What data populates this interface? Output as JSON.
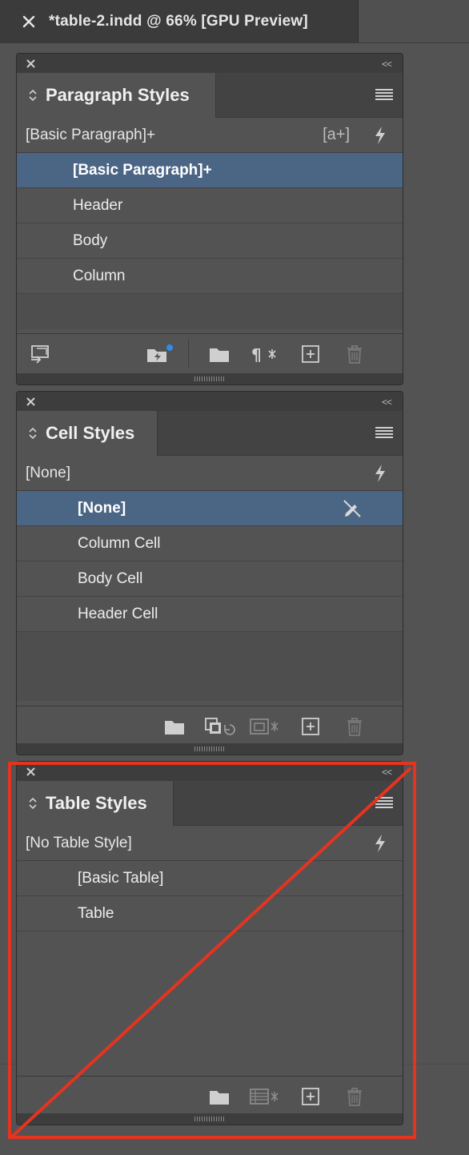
{
  "document_tab": {
    "title": "*table-2.indd @ 66% [GPU Preview]"
  },
  "panels": {
    "paragraph_styles": {
      "title": "Paragraph Styles",
      "current": "[Basic Paragraph]+",
      "new_from_selection_glyph": "[a+]",
      "items": [
        "[Basic Paragraph]+",
        "Header",
        "Body",
        "Column"
      ]
    },
    "cell_styles": {
      "title": "Cell Styles",
      "current": "[None]",
      "items": [
        "[None]",
        "Column Cell",
        "Body Cell",
        "Header Cell"
      ]
    },
    "table_styles": {
      "title": "Table Styles",
      "current": "[No Table Style]",
      "items": [
        "[Basic Table]",
        "Table"
      ]
    }
  },
  "collapse_glyph": "<<",
  "colors": {
    "selection": "#4b6584",
    "annotation": "#e6331f",
    "badge": "#2d8ceb"
  }
}
